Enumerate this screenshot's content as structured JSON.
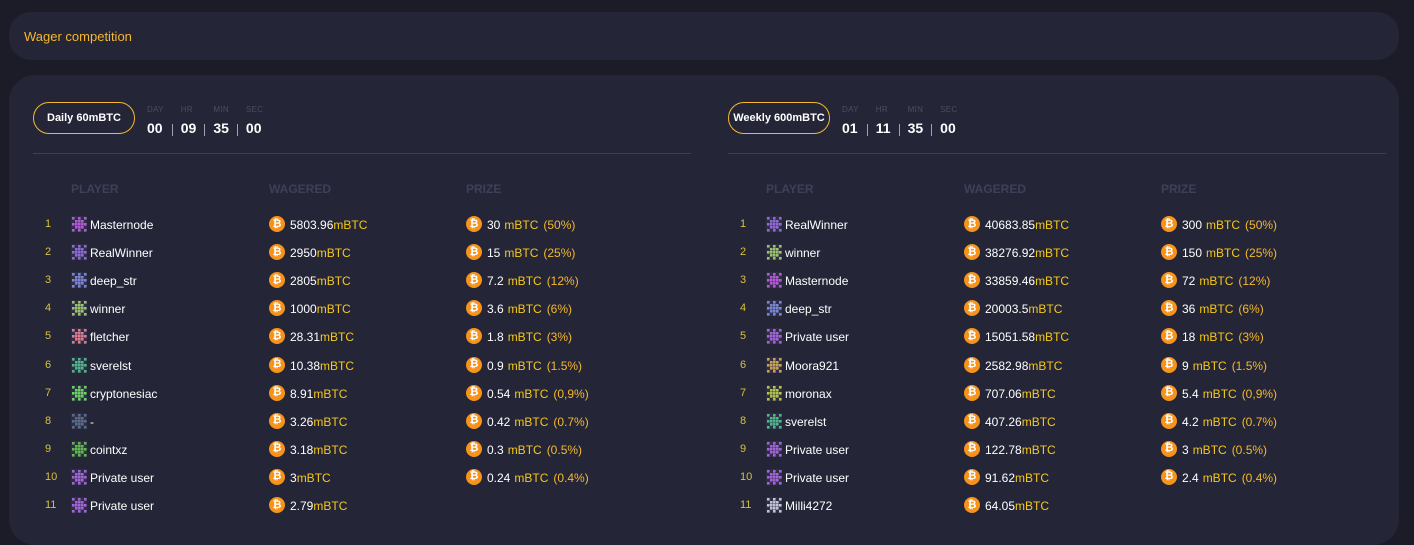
{
  "header": {
    "title": "Wager competition"
  },
  "colors": {
    "accent": "#f5b82e",
    "bitcoin": "#f7931a",
    "panel": "#242536",
    "background": "#1b1c27"
  },
  "columns": {
    "player": "PLAYER",
    "wagered": "WAGERED",
    "prize": "PRIZE"
  },
  "icons": {
    "coin": "bitcoin-coin-icon",
    "avatar": "pixel-avatar-icon"
  },
  "competitions": [
    {
      "label": "Daily 60mBTC",
      "timer": [
        {
          "label": "DAY",
          "value": "00"
        },
        {
          "label": "HR",
          "value": "09"
        },
        {
          "label": "MIN",
          "value": "35"
        },
        {
          "label": "SEC",
          "value": "00"
        }
      ],
      "rows": [
        {
          "rank": "1",
          "player": "Masternode",
          "wagered": "5803.96",
          "wunit": "mBTC",
          "prize": "30",
          "punit": "mBTC",
          "pct": "(50%)",
          "avatar": "#b45ad6"
        },
        {
          "rank": "2",
          "player": "RealWinner",
          "wagered": "2950",
          "wunit": "mBTC",
          "prize": "15",
          "punit": "mBTC",
          "pct": "(25%)",
          "avatar": "#8e6ad8"
        },
        {
          "rank": "3",
          "player": "deep_str",
          "wagered": "2805",
          "wunit": "mBTC",
          "prize": "7.2",
          "punit": "mBTC",
          "pct": "(12%)",
          "avatar": "#7a85d6"
        },
        {
          "rank": "4",
          "player": "winner",
          "wagered": "1000",
          "wunit": "mBTC",
          "prize": "3.6",
          "punit": "mBTC",
          "pct": "(6%)",
          "avatar": "#9cc26e"
        },
        {
          "rank": "5",
          "player": "fletcher",
          "wagered": "28.31",
          "wunit": "mBTC",
          "prize": "1.8",
          "punit": "mBTC",
          "pct": "(3%)",
          "avatar": "#e07a8e"
        },
        {
          "rank": "6",
          "player": "sverelst",
          "wagered": "10.38",
          "wunit": "mBTC",
          "prize": "0.9",
          "punit": "mBTC",
          "pct": "(1.5%)",
          "avatar": "#4fb58a"
        },
        {
          "rank": "7",
          "player": "cryptonesiac",
          "wagered": "8.91",
          "wunit": "mBTC",
          "prize": "0.54",
          "punit": "mBTC",
          "pct": "(0,9%)",
          "avatar": "#6fcf6a"
        },
        {
          "rank": "8",
          "player": "-",
          "wagered": "3.26",
          "wunit": "mBTC",
          "prize": "0.42",
          "punit": "mBTC",
          "pct": "(0.7%)",
          "avatar": "#5b6c8a"
        },
        {
          "rank": "9",
          "player": "cointxz",
          "wagered": "3.18",
          "wunit": "mBTC",
          "prize": "0.3",
          "punit": "mBTC",
          "pct": "(0.5%)",
          "avatar": "#63b84d"
        },
        {
          "rank": "10",
          "player": "Private user",
          "wagered": "3",
          "wunit": "mBTC",
          "prize": "0.24",
          "punit": "mBTC",
          "pct": "(0.4%)",
          "avatar": "#a264d6"
        },
        {
          "rank": "11",
          "player": "Private user",
          "wagered": "2.79",
          "wunit": "mBTC",
          "avatar": "#a264d6"
        }
      ]
    },
    {
      "label": "Weekly 600mBTC",
      "timer": [
        {
          "label": "DAY",
          "value": "01"
        },
        {
          "label": "HR",
          "value": "11"
        },
        {
          "label": "MIN",
          "value": "35"
        },
        {
          "label": "SEC",
          "value": "00"
        }
      ],
      "rows": [
        {
          "rank": "1",
          "player": "RealWinner",
          "wagered": "40683.85",
          "wunit": "mBTC",
          "prize": "300",
          "punit": "mBTC",
          "pct": "(50%)",
          "avatar": "#8e6ad8"
        },
        {
          "rank": "2",
          "player": "winner",
          "wagered": "38276.92",
          "wunit": "mBTC",
          "prize": "150",
          "punit": "mBTC",
          "pct": "(25%)",
          "avatar": "#9cc26e"
        },
        {
          "rank": "3",
          "player": "Masternode",
          "wagered": "33859.46",
          "wunit": "mBTC",
          "prize": "72",
          "punit": "mBTC",
          "pct": "(12%)",
          "avatar": "#b45ad6"
        },
        {
          "rank": "4",
          "player": "deep_str",
          "wagered": "20003.5",
          "wunit": "mBTC",
          "prize": "36",
          "punit": "mBTC",
          "pct": "(6%)",
          "avatar": "#7a85d6"
        },
        {
          "rank": "5",
          "player": "Private user",
          "wagered": "15051.58",
          "wunit": "mBTC",
          "prize": "18",
          "punit": "mBTC",
          "pct": "(3%)",
          "avatar": "#a264d6"
        },
        {
          "rank": "6",
          "player": "Moora921",
          "wagered": "2582.98",
          "wunit": "mBTC",
          "prize": "9",
          "punit": "mBTC",
          "pct": "(1.5%)",
          "avatar": "#c9a25a"
        },
        {
          "rank": "7",
          "player": "moronax",
          "wagered": "707.06",
          "wunit": "mBTC",
          "prize": "5.4",
          "punit": "mBTC",
          "pct": "(0,9%)",
          "avatar": "#b5c24a"
        },
        {
          "rank": "8",
          "player": "sverelst",
          "wagered": "407.26",
          "wunit": "mBTC",
          "prize": "4.2",
          "punit": "mBTC",
          "pct": "(0.7%)",
          "avatar": "#4fb58a"
        },
        {
          "rank": "9",
          "player": "Private user",
          "wagered": "122.78",
          "wunit": "mBTC",
          "prize": "3",
          "punit": "mBTC",
          "pct": "(0.5%)",
          "avatar": "#a264d6"
        },
        {
          "rank": "10",
          "player": "Private user",
          "wagered": "91.62",
          "wunit": "mBTC",
          "prize": "2.4",
          "punit": "mBTC",
          "pct": "(0.4%)",
          "avatar": "#a264d6"
        },
        {
          "rank": "11",
          "player": "Milli4272",
          "wagered": "64.05",
          "wunit": "mBTC",
          "avatar": "#c2c2d6"
        }
      ]
    }
  ]
}
